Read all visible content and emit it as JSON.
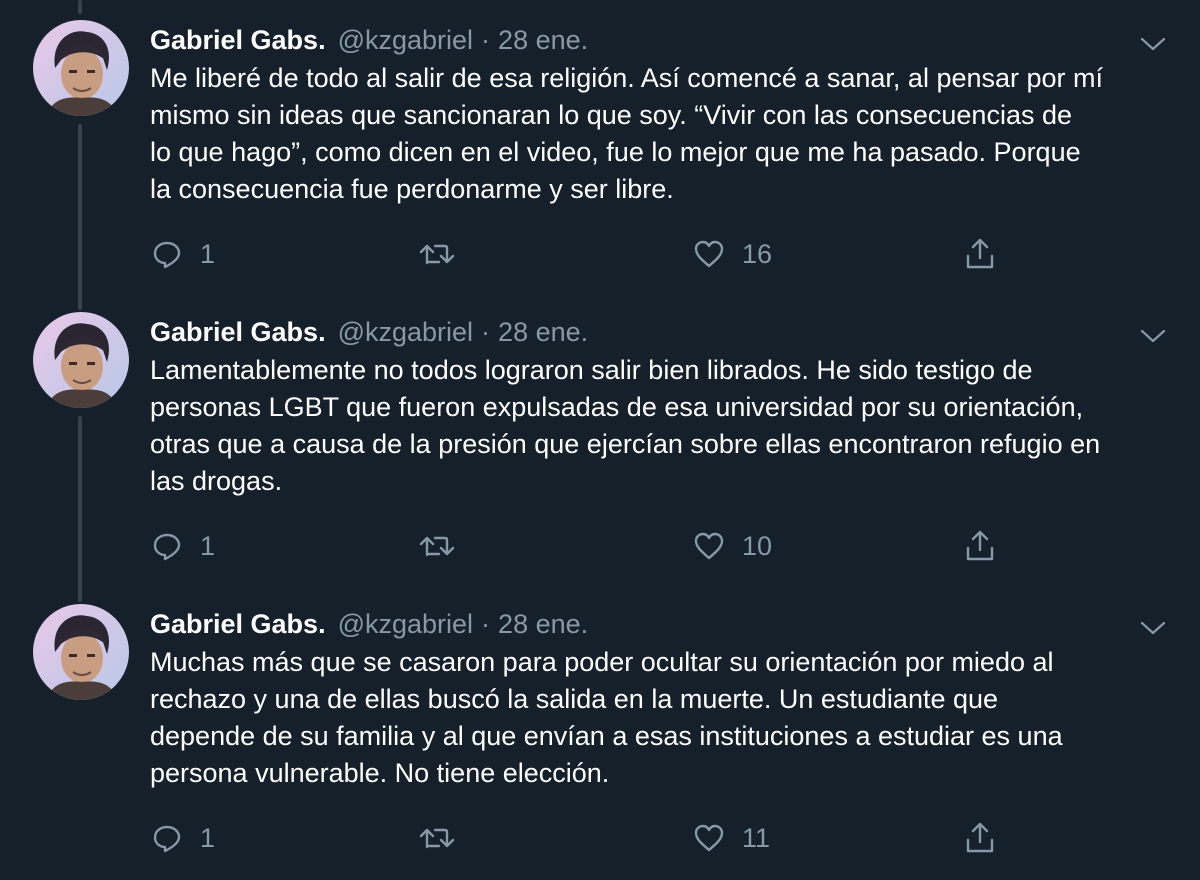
{
  "tweets": [
    {
      "name": "Gabriel Gabs.",
      "handle": "@kzgabriel",
      "separator": "·",
      "date": "28 ene.",
      "lines": [
        "Me liberé de todo al salir de esa religión. Así comencé a sanar, al pensar por mí",
        "mismo sin ideas que sancionaran lo que soy. “Vivir con las consecuencias de",
        "lo que hago”, como dicen en el video, fue lo mejor que me ha pasado. Porque",
        "la consecuencia fue perdonarme y ser libre."
      ],
      "replies": "1",
      "retweets": "",
      "likes": "16"
    },
    {
      "name": "Gabriel Gabs.",
      "handle": "@kzgabriel",
      "separator": "·",
      "date": "28 ene.",
      "lines": [
        "Lamentablemente no todos lograron salir bien librados. He sido testigo de",
        "personas LGBT que fueron expulsadas de esa universidad por su orientación,",
        "otras que a causa de la presión que ejercían sobre ellas encontraron refugio en",
        "las drogas."
      ],
      "replies": "1",
      "retweets": "",
      "likes": "10"
    },
    {
      "name": "Gabriel Gabs.",
      "handle": "@kzgabriel",
      "separator": "·",
      "date": "28 ene.",
      "lines": [
        "Muchas más que se casaron para poder ocultar su orientación por miedo al",
        "rechazo y una de ellas buscó la salida en la muerte. Un estudiante que",
        "depende de su familia y al que envían a esas instituciones a estudiar es una",
        "persona vulnerable. No tiene elección."
      ],
      "replies": "1",
      "retweets": "",
      "likes": "11"
    }
  ],
  "icons": {
    "caret": "chevron-down-icon",
    "reply": "reply-icon",
    "retweet": "retweet-icon",
    "like": "like-icon",
    "share": "share-icon"
  },
  "colors": {
    "background": "#15202b",
    "text": "#ffffff",
    "secondary": "#8899a6",
    "thread_line": "#38444d"
  }
}
